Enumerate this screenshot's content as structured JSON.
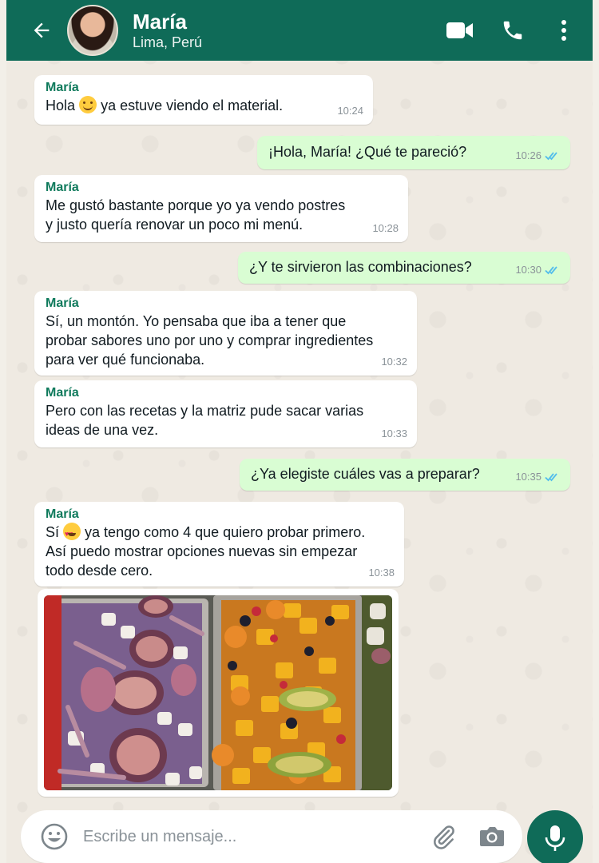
{
  "header": {
    "contact_name": "María",
    "contact_status": "Lima, Perú"
  },
  "messages": [
    {
      "direction": "in",
      "sender": "María",
      "lines": [
        "Hola",
        "ya estuve viendo el material."
      ],
      "emoji": "smile",
      "time": "10:24"
    },
    {
      "direction": "out",
      "text": "¡Hola, María! ¿Qué te pareció?",
      "time": "10:26",
      "status": "read"
    },
    {
      "direction": "in",
      "sender": "María",
      "lines": [
        "Me gustó bastante porque yo ya vendo postres",
        "y justo quería renovar un poco mi menú."
      ],
      "time": "10:28"
    },
    {
      "direction": "out",
      "text": "¿Y te sirvieron las combinaciones?",
      "time": "10:30",
      "status": "read"
    },
    {
      "direction": "in",
      "sender": "María",
      "lines": [
        "Sí, un montón. Yo pensaba que iba a tener que",
        "probar sabores uno por uno y comprar ingredientes",
        "para ver qué funcionaba."
      ],
      "time": "10:32"
    },
    {
      "direction": "in",
      "sender": "María",
      "lines": [
        "Pero con las recetas y la matriz pude sacar varias",
        "ideas de una vez."
      ],
      "time": "10:33"
    },
    {
      "direction": "out",
      "text": "¿Ya elegiste cuáles vas a preparar?",
      "time": "10:35",
      "status": "read"
    },
    {
      "direction": "in",
      "sender": "María",
      "lines": [
        "Sí",
        "ya tengo como 4 que quiero probar primero.",
        "Así puedo mostrar opciones nuevas sin empezar",
        "todo desde cero."
      ],
      "emoji": "heart-eyes",
      "time": "10:38"
    }
  ],
  "photo_message": {
    "icon": "fruit-dessert-platter-photo"
  },
  "composer": {
    "placeholder": "Escribe un mensaje..."
  },
  "colors": {
    "header": "#0f6b58",
    "outgoing_bubble": "#d9fdd3",
    "incoming_bubble": "#ffffff",
    "sender_name": "#0f7a5c",
    "read_ticks": "#53bdeb",
    "chat_background": "#efeae2"
  }
}
